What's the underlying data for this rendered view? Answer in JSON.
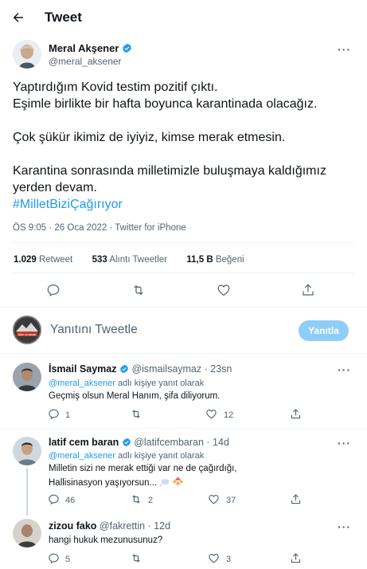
{
  "header": {
    "title": "Tweet"
  },
  "main_tweet": {
    "author_name": "Meral Akşener",
    "author_handle": "@meral_aksener",
    "lines": [
      "Yaptırdığım Kovid testim pozitif çıktı.",
      "Eşimle birlikte bir hafta boyunca karantinada olacağız.",
      "Çok şükür ikimiz de iyiyiz, kimse merak etmesin.",
      "Karantina sonrasında milletimizle buluşmaya kaldığımız",
      "yerden devam."
    ],
    "hashtag": "#MilletBiziÇağırıyor",
    "meta": "ÖS 9:05 · 26 Oca 2022 · Twitter for iPhone",
    "stats": {
      "retweet_count": "1.029",
      "retweet_label": "Retweet",
      "quote_count": "533",
      "quote_label": "Alıntı Tweetler",
      "like_count": "11,5 B",
      "like_label": "Beğeni"
    }
  },
  "reply_composer": {
    "placeholder": "Yanıtını Tweetle",
    "button_label": "Yanıtla",
    "avatar_text": "ÖĞR. Gİ. MARK"
  },
  "replies": [
    {
      "name": "İsmail Saymaz",
      "handle": "@ismailsaymaz",
      "time": "· 23sn",
      "reply_to_handle": "@meral_aksener",
      "reply_to_suffix": "adlı kişiye yanıt olarak",
      "text": "Geçmiş olsun Meral Hanım, şifa diliyorum.",
      "replies": "1",
      "retweets": "",
      "likes": "12",
      "verified": true
    },
    {
      "name": "latif cem baran",
      "handle": "@latifcembaran",
      "time": "· 14d",
      "reply_to_handle": "@meral_aksener",
      "reply_to_suffix": "adlı kişiye yanıt olarak",
      "text_line1": "Milletin sizi ne merak ettiği var ne de çağırdığı,",
      "text_line2": "Hallisinasyon yaşıyorsun...",
      "replies": "46",
      "retweets": "2",
      "likes": "37",
      "verified": true
    },
    {
      "name": "zizou fako",
      "handle": "@fakrettin",
      "time": "· 12d",
      "text": "hangi hukuk mezunusunuz?",
      "replies": "5",
      "retweets": "",
      "likes": "3",
      "verified": false
    }
  ],
  "colors": {
    "accent": "#1d9bf0",
    "reply_button": "#8ecdf8",
    "text": "#0f1419",
    "muted": "#536471"
  }
}
